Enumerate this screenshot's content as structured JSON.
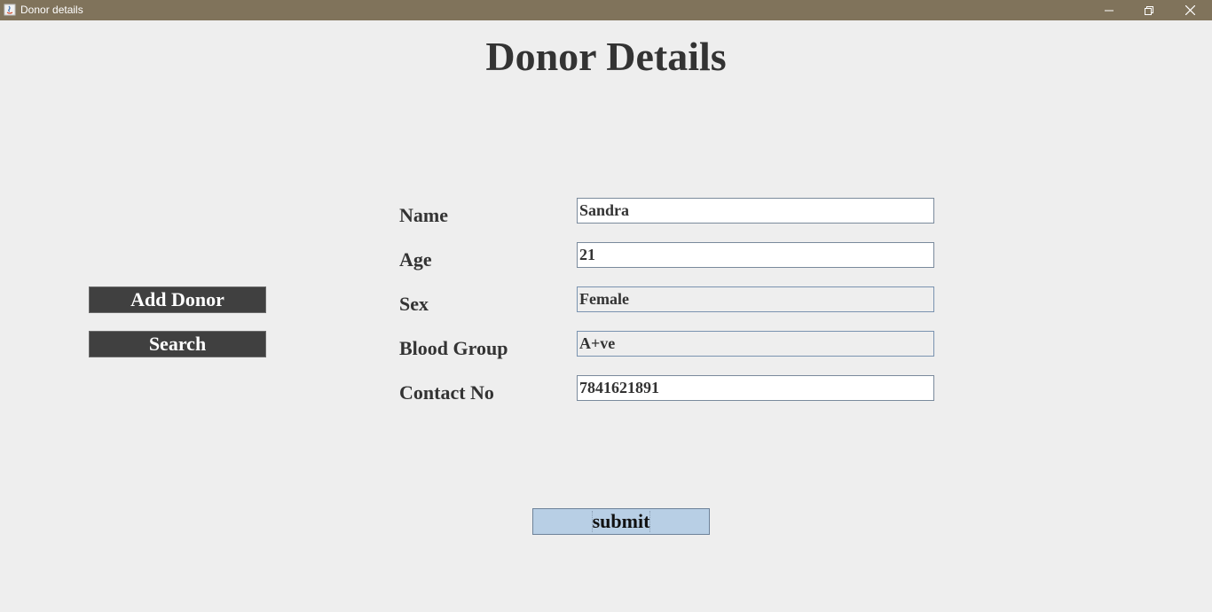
{
  "window": {
    "title": "Donor details",
    "icon": "java-app-icon",
    "controls": [
      "minimize-icon",
      "restore-icon",
      "close-icon"
    ],
    "titlebar_color": "#80735b"
  },
  "page": {
    "title": "Donor Details"
  },
  "sidebar": {
    "add_donor_label": "Add Donor",
    "search_label": "Search",
    "button_color": "#404040"
  },
  "form": {
    "name": {
      "label": "Name",
      "value": "Sandra"
    },
    "age": {
      "label": "Age",
      "value": "21"
    },
    "sex": {
      "label": "Sex",
      "value": "Female"
    },
    "blood_group": {
      "label": "Blood Group",
      "value": "A+ve"
    },
    "contact_no": {
      "label": "Contact No",
      "value": "7841621891"
    },
    "submit_label": "submit",
    "submit_color": "#b8cfe5"
  }
}
